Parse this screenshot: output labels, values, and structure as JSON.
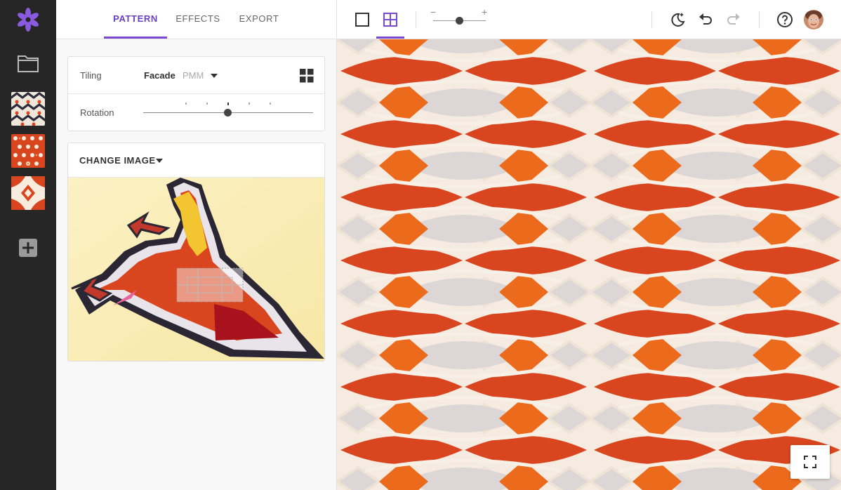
{
  "app": {
    "brand_color": "#7b4ad0",
    "icons": {
      "logo": "asterisk-logo-icon",
      "folder": "folder-icon",
      "add": "add-square-icon"
    },
    "recent_patterns": [
      {
        "name": "pattern-thumbnail-1"
      },
      {
        "name": "pattern-thumbnail-2"
      },
      {
        "name": "pattern-thumbnail-3"
      }
    ]
  },
  "panel": {
    "tabs": [
      {
        "label": "PATTERN",
        "active": true
      },
      {
        "label": "EFFECTS",
        "active": false
      },
      {
        "label": "EXPORT",
        "active": false
      }
    ],
    "tiling": {
      "label": "Tiling",
      "value": "Facade",
      "code": "PMM"
    },
    "rotation": {
      "label": "Rotation",
      "steps": 5,
      "selected_step": 3
    },
    "source_image": {
      "button_label": "CHANGE IMAGE"
    }
  },
  "toolbar": {
    "view_single_icon": "square-icon",
    "view_tiled_icon": "grid-icon",
    "active_view": "tiled",
    "zoom": {
      "minus": "−",
      "plus": "+",
      "level": 0.5
    },
    "theme_icon": "moon-sparkle-icon",
    "undo_icon": "undo-icon",
    "redo_icon": "redo-icon",
    "help_icon": "help-circle-icon",
    "avatar_icon": "user-avatar"
  },
  "canvas": {
    "fullscreen_icon": "fullscreen-icon",
    "colors": {
      "red": "#d9451f",
      "orange": "#ec6a1c",
      "cream": "#f7ecdd",
      "grey": "#d8d4d4"
    }
  }
}
